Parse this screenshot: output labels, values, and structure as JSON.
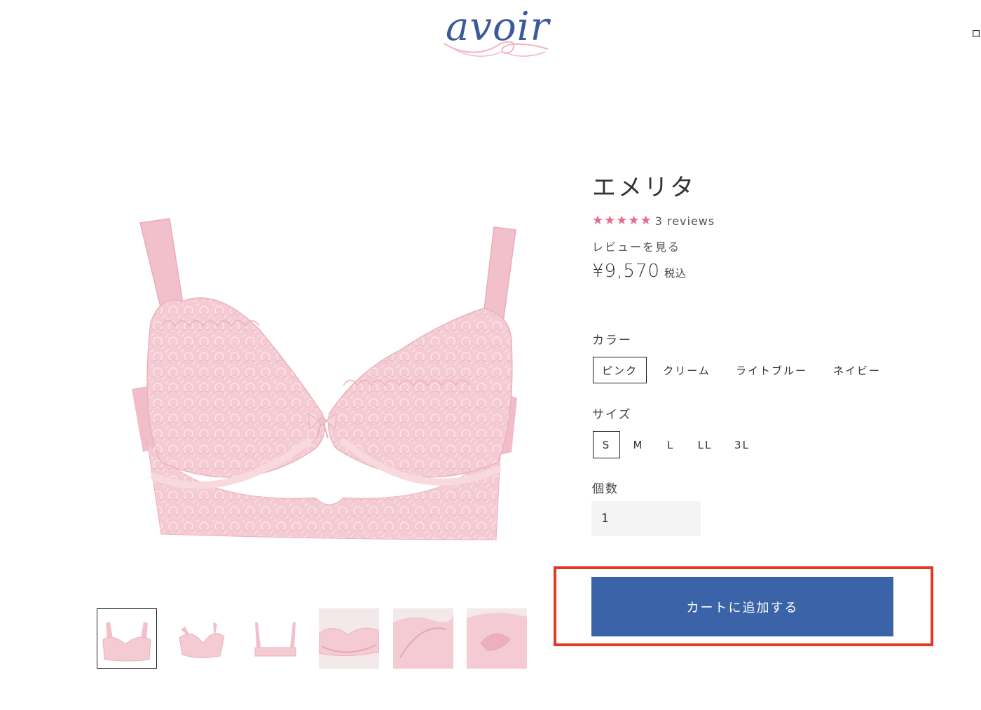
{
  "header": {
    "logo_text": "avoir",
    "edge_glyph": "ロ"
  },
  "product": {
    "title": "エメリタ",
    "rating": 5,
    "reviews_text": "3 reviews",
    "see_reviews": "レビューを見る",
    "price": "¥9,570",
    "tax_label": "税込"
  },
  "color": {
    "label": "カラー",
    "options": [
      "ピンク",
      "クリーム",
      "ライトブルー",
      "ネイビー"
    ],
    "selected": "ピンク"
  },
  "size": {
    "label": "サイズ",
    "options": [
      "S",
      "M",
      "L",
      "LL",
      "3L"
    ],
    "selected": "S"
  },
  "quantity": {
    "label": "個数",
    "value": "1"
  },
  "cart": {
    "button_label": "カートに追加する"
  },
  "colors": {
    "brand_blue": "#3b64a8",
    "star_pink": "#e86b8c",
    "highlight_red": "#e03a24",
    "product_pink": "#f2c4cd"
  },
  "gallery": {
    "thumbnail_count": 6,
    "active_index": 0
  }
}
